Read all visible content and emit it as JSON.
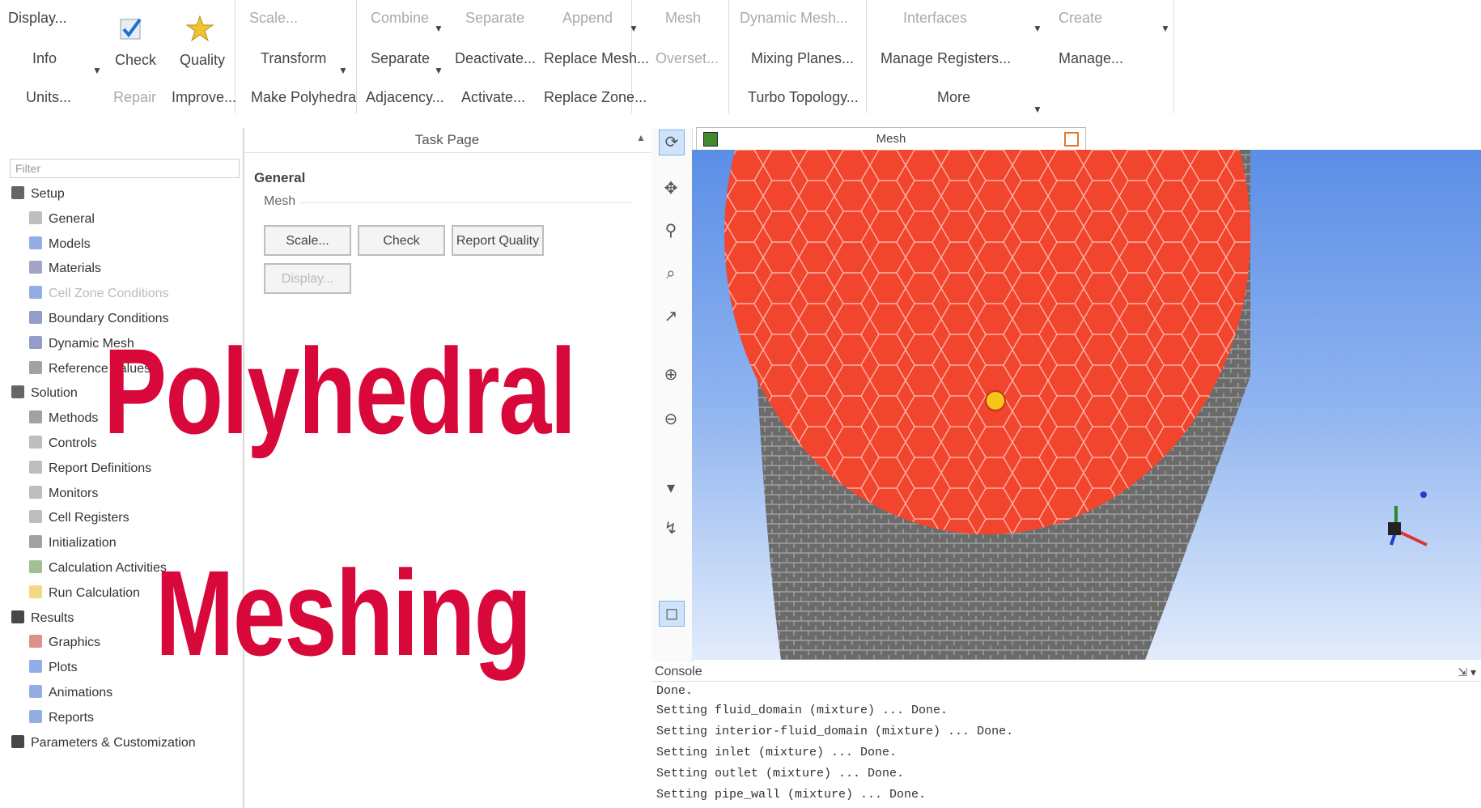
{
  "ribbon": {
    "row1": [
      "Display...",
      "Scale...",
      "Combine",
      "Separate",
      "Append",
      "Mesh",
      "Dynamic Mesh...",
      "Interfaces",
      "Create"
    ],
    "info": "Info",
    "check": "Check",
    "quality": "Quality",
    "units": "Units...",
    "repair": "Repair",
    "improve": "Improve...",
    "transform": "Transform",
    "make_polyhedra": "Make Polyhedra",
    "separate": "Separate",
    "adjacency": "Adjacency...",
    "deactivate": "Deactivate...",
    "activate": "Activate...",
    "replace_mesh": "Replace Mesh...",
    "replace_zone": "Replace Zone...",
    "overset": "Overset...",
    "mixing_planes": "Mixing Planes...",
    "turbo_topology": "Turbo Topology...",
    "manage_registers": "Manage Registers...",
    "more": "More",
    "manage": "Manage..."
  },
  "tree": {
    "filter_placeholder": "Filter",
    "items": [
      {
        "label": "Setup",
        "level": 0,
        "icon": "setup-icon",
        "faded": false
      },
      {
        "label": "General",
        "level": 1,
        "icon": "general-icon",
        "faded": false
      },
      {
        "label": "Models",
        "level": 1,
        "icon": "models-icon",
        "faded": false
      },
      {
        "label": "Materials",
        "level": 1,
        "icon": "materials-icon",
        "faded": false
      },
      {
        "label": "Cell Zone Conditions",
        "level": 1,
        "icon": "cell-zone-icon",
        "faded": true
      },
      {
        "label": "Boundary Conditions",
        "level": 1,
        "icon": "boundary-icon",
        "faded": false
      },
      {
        "label": "Dynamic Mesh",
        "level": 1,
        "icon": "dynamic-mesh-icon",
        "faded": false
      },
      {
        "label": "Reference Values",
        "level": 1,
        "icon": "reference-icon",
        "faded": false
      },
      {
        "label": "Solution",
        "level": 0,
        "icon": "solution-icon",
        "faded": false
      },
      {
        "label": "Methods",
        "level": 1,
        "icon": "methods-icon",
        "faded": false
      },
      {
        "label": "Controls",
        "level": 1,
        "icon": "controls-icon",
        "faded": false
      },
      {
        "label": "Report Definitions",
        "level": 1,
        "icon": "report-def-icon",
        "faded": false
      },
      {
        "label": "Monitors",
        "level": 1,
        "icon": "monitors-icon",
        "faded": false
      },
      {
        "label": "Cell Registers",
        "level": 1,
        "icon": "cell-registers-icon",
        "faded": false
      },
      {
        "label": "Initialization",
        "level": 1,
        "icon": "initialization-icon",
        "faded": false
      },
      {
        "label": "Calculation Activities",
        "level": 1,
        "icon": "calc-activities-icon",
        "faded": false
      },
      {
        "label": "Run Calculation",
        "level": 1,
        "icon": "run-calc-icon",
        "faded": false
      },
      {
        "label": "Results",
        "level": 0,
        "icon": "results-icon",
        "faded": false
      },
      {
        "label": "Graphics",
        "level": 1,
        "icon": "graphics-icon",
        "faded": false
      },
      {
        "label": "Plots",
        "level": 1,
        "icon": "plots-icon",
        "faded": false
      },
      {
        "label": "Animations",
        "level": 1,
        "icon": "animations-icon",
        "faded": false
      },
      {
        "label": "Reports",
        "level": 1,
        "icon": "reports-icon",
        "faded": false
      },
      {
        "label": "Parameters & Customization",
        "level": 0,
        "icon": "parameters-icon",
        "faded": false
      }
    ]
  },
  "task": {
    "header": "Task Page",
    "section": "General",
    "mesh_label": "Mesh",
    "scale_btn": "Scale...",
    "check_btn": "Check",
    "report_quality_btn": "Report Quality",
    "display_btn": "Display..."
  },
  "viewport": {
    "tab_label": "Mesh"
  },
  "console": {
    "title": "Console",
    "lines": [
      "Done.",
      "Setting fluid_domain (mixture) ... Done.",
      "Setting interior-fluid_domain (mixture) ... Done.",
      "Setting inlet (mixture) ... Done.",
      "Setting outlet (mixture) ... Done.",
      "Setting pipe_wall (mixture) ... Done."
    ]
  },
  "overlay": {
    "line1": "Polyhedral",
    "line2": "Meshing",
    "color": "#d8083a"
  },
  "colors": {
    "mesh_face": "#f2452e",
    "mesh_wall": "#6a6a6a",
    "accent": "#1e6fd0"
  }
}
